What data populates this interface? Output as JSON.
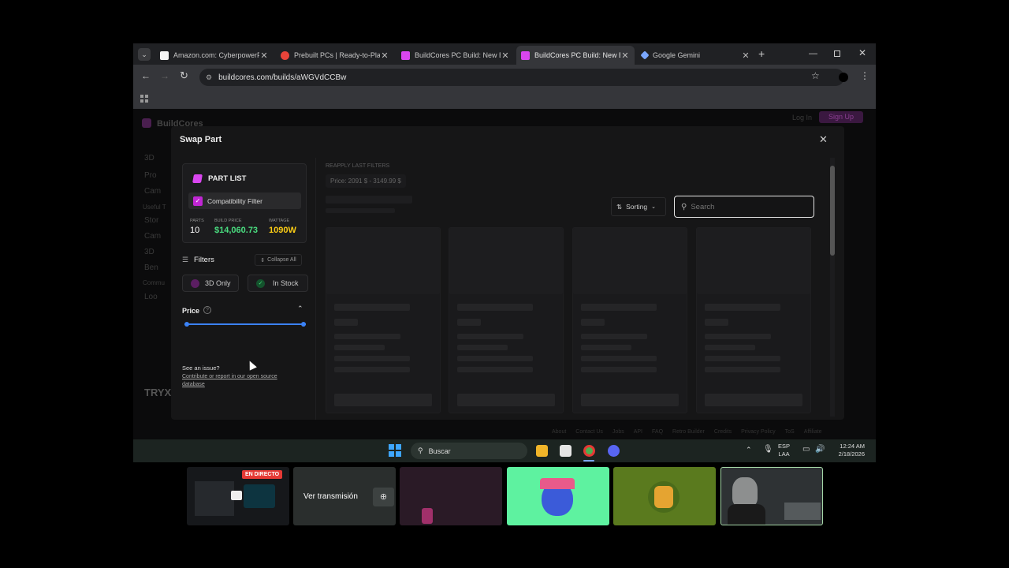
{
  "browser": {
    "tabs": [
      {
        "title": "Amazon.com: CyberpowerP",
        "favicon_color": "#f5f5f5"
      },
      {
        "title": "Prebuilt PCs | Ready-to-Play",
        "favicon_color": "#e8443a"
      },
      {
        "title": "BuildCores PC Build: New Bu",
        "favicon_color": "#d946ef"
      },
      {
        "title": "BuildCores PC Build: New Bu",
        "favicon_color": "#d946ef"
      },
      {
        "title": "Google Gemini",
        "favicon_color": "#7aa7ff"
      }
    ],
    "url": "buildcores.com/builds/aWGVdCCBw"
  },
  "background_page": {
    "logo": "BuildCores",
    "nav_items": [
      "3D",
      "Pro",
      "Cam",
      "Useful T",
      "Stor",
      "Cam",
      "3D",
      "Ben",
      "Commu",
      "Loo"
    ],
    "login": "Log In",
    "signup": "Sign Up",
    "brand_banner": "TRYX",
    "footer_links": [
      "About",
      "Contact Us",
      "Jobs",
      "API",
      "FAQ",
      "Retro Builder",
      "Credits",
      "Privacy Policy",
      "ToS",
      "Affiliate"
    ]
  },
  "modal": {
    "title": "Swap Part",
    "part_list": {
      "heading": "PART LIST",
      "compat_filter": "Compatibility Filter",
      "stats": [
        {
          "label": "PARTS",
          "value": "10",
          "color": "#ffffff"
        },
        {
          "label": "BUILD PRICE",
          "value": "$14,060.73",
          "color": "#4ade80"
        },
        {
          "label": "WATTAGE",
          "value": "1090W",
          "color": "#facc15"
        }
      ]
    },
    "filters": {
      "label": "Filters",
      "collapse_label": "Collapse All",
      "chip_3d": "3D Only",
      "chip_stock": "In Stock",
      "price_label": "Price",
      "price_slider_min": 0,
      "price_slider_max": 1
    },
    "issue": {
      "question": "See an issue?",
      "link": "Contribute or report in our open source database"
    },
    "reapply": "REAPPLY LAST FILTERS",
    "price_chip": "Price: 2091 $ - 3149.99 $",
    "sorting_label": "Sorting",
    "search_placeholder": "Search"
  },
  "taskbar": {
    "search_placeholder": "Buscar",
    "lang_top": "ESP",
    "lang_bottom": "LAA",
    "time": "12:24 AM",
    "date": "2/18/2026"
  },
  "stream": {
    "live_badge": "EN DIRECTO",
    "watch_label": "Ver transmisión"
  }
}
